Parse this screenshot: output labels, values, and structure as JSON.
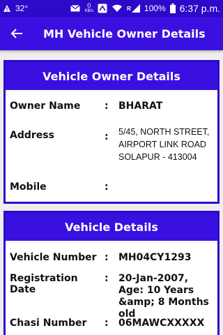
{
  "statusbar": {
    "temperature": "32°",
    "netspeed_value": "0",
    "netspeed_unit": "KB/s",
    "network_type": "R",
    "battery": "100%",
    "time": "6:37 p.m."
  },
  "appbar": {
    "title": "MH Vehicle Owner Details"
  },
  "owner_card": {
    "title": "Vehicle Owner Details",
    "rows": [
      {
        "label": "Owner Name",
        "colon": ":",
        "value": "BHARAT"
      },
      {
        "label": "Address",
        "colon": ":",
        "value": "5/45, NORTH STREET, AIRPORT LINK ROAD SOLAPUR - 413004"
      },
      {
        "label": "Mobile",
        "colon": ":",
        "value": ""
      }
    ]
  },
  "vehicle_card": {
    "title": "Vehicle Details",
    "rows": [
      {
        "label": "Vehicle Number",
        "colon": ":",
        "value": "MH04CY1293"
      },
      {
        "label": "Registration Date",
        "colon": ":",
        "value": "20-Jan-2007, Age: 10 Years &amp; 8 Months old"
      },
      {
        "label": "Chasi Number",
        "colon": ":",
        "value": "06MAWCXXXXX"
      }
    ]
  },
  "colors": {
    "primary": "#3a10e0",
    "primary_dark": "#2d09c9",
    "background": "#eeeeee"
  }
}
